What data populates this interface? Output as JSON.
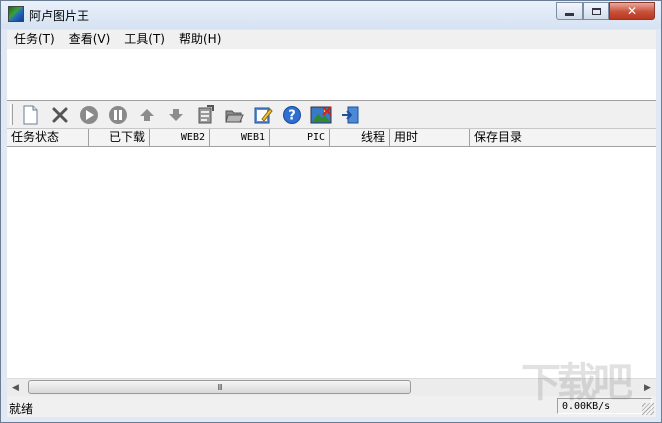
{
  "window": {
    "title": "阿卢图片王"
  },
  "menu": [
    {
      "label": "任务(T)"
    },
    {
      "label": "查看(V)"
    },
    {
      "label": "工具(T)"
    },
    {
      "label": "帮助(H)"
    }
  ],
  "toolbar": {
    "buttons": [
      {
        "icon": "new-task-icon"
      },
      {
        "icon": "delete-icon"
      },
      {
        "icon": "start-icon"
      },
      {
        "icon": "pause-icon"
      },
      {
        "icon": "move-up-icon"
      },
      {
        "icon": "move-down-icon"
      },
      {
        "icon": "properties-icon"
      },
      {
        "icon": "open-folder-icon"
      },
      {
        "icon": "edit-icon"
      },
      {
        "icon": "help-icon"
      },
      {
        "icon": "image-viewer-icon"
      },
      {
        "icon": "exit-icon"
      }
    ]
  },
  "list": {
    "columns": [
      "任务状态",
      "已下载",
      "WEB2",
      "WEB1",
      "PIC",
      "线程",
      "用时",
      "保存目录"
    ],
    "rows": []
  },
  "status": {
    "left": "就绪",
    "speed": "0.00KB/s"
  },
  "watermark": "下载吧"
}
